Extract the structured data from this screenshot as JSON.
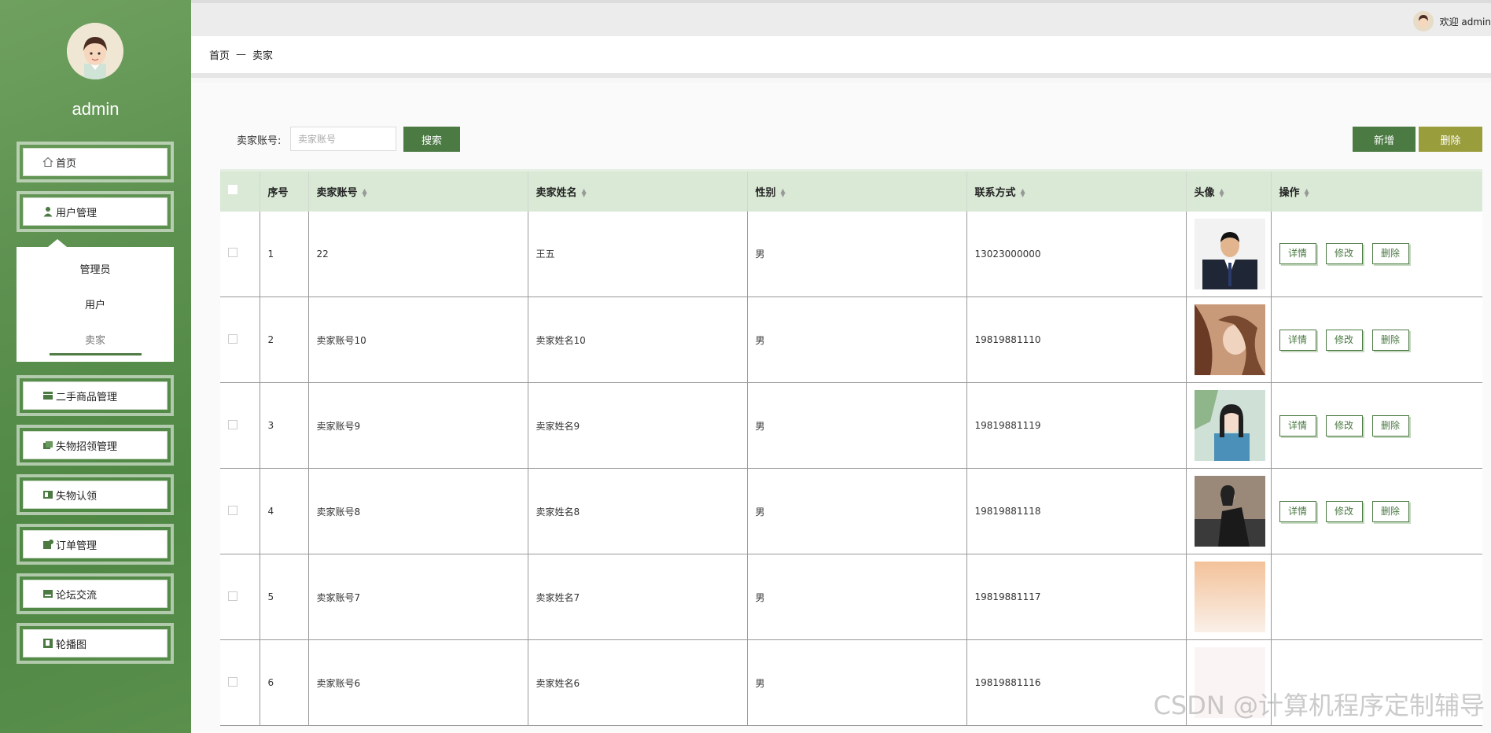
{
  "user": {
    "name": "admin",
    "welcome": "欢迎 admin"
  },
  "sidebar": {
    "items": [
      {
        "label": "首页",
        "icon": "home-icon"
      },
      {
        "label": "用户管理",
        "icon": "user-icon"
      },
      {
        "label": "二手商品管理",
        "icon": "goods-icon"
      },
      {
        "label": "失物招领管理",
        "icon": "folder-icon"
      },
      {
        "label": "失物认领",
        "icon": "claim-icon"
      },
      {
        "label": "订单管理",
        "icon": "order-icon"
      },
      {
        "label": "论坛交流",
        "icon": "forum-icon"
      },
      {
        "label": "轮播图",
        "icon": "carousel-icon"
      }
    ],
    "submenu": [
      "管理员",
      "用户",
      "卖家"
    ]
  },
  "breadcrumb": {
    "home": "首页",
    "sep": "—",
    "current": "卖家"
  },
  "search": {
    "label": "卖家账号:",
    "placeholder": "卖家账号",
    "button": "搜索"
  },
  "actions": {
    "add": "新增",
    "delete": "删除"
  },
  "table": {
    "headers": [
      "序号",
      "卖家账号",
      "卖家姓名",
      "性别",
      "联系方式",
      "头像",
      "操作"
    ],
    "ops": [
      "详情",
      "修改",
      "删除"
    ],
    "rows": [
      {
        "no": "1",
        "account": "22",
        "name": "王五",
        "gender": "男",
        "phone": "13023000000"
      },
      {
        "no": "2",
        "account": "卖家账号10",
        "name": "卖家姓名10",
        "gender": "男",
        "phone": "19819881110"
      },
      {
        "no": "3",
        "account": "卖家账号9",
        "name": "卖家姓名9",
        "gender": "男",
        "phone": "19819881119"
      },
      {
        "no": "4",
        "account": "卖家账号8",
        "name": "卖家姓名8",
        "gender": "男",
        "phone": "19819881118"
      },
      {
        "no": "5",
        "account": "卖家账号7",
        "name": "卖家姓名7",
        "gender": "男",
        "phone": "19819881117"
      },
      {
        "no": "6",
        "account": "卖家账号6",
        "name": "卖家姓名6",
        "gender": "男",
        "phone": "19819881116"
      }
    ]
  },
  "watermark": "CSDN @计算机程序定制辅导",
  "colors": {
    "primary": "#4b7a43",
    "danger": "#9a9d3c",
    "header_bg": "#d9e9d5",
    "sidebar": "#5d9150"
  }
}
